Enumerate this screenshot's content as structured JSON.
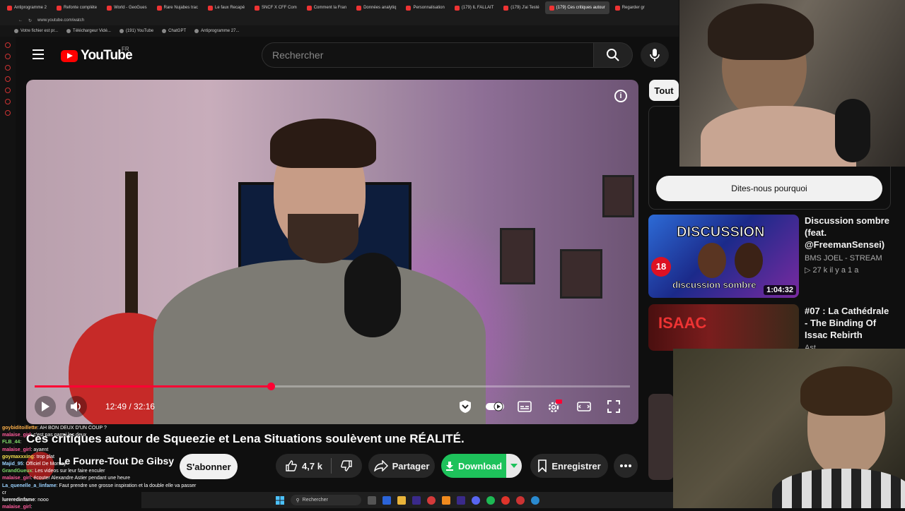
{
  "browser": {
    "tabs": [
      {
        "label": "Antiprogramme 2"
      },
      {
        "label": "Refonte complète"
      },
      {
        "label": "World - GeoGues"
      },
      {
        "label": "Rare Nujabes trac"
      },
      {
        "label": "Le faux Recapé"
      },
      {
        "label": "SNCF X CFF Com"
      },
      {
        "label": "Comment la Fran"
      },
      {
        "label": "Données analytiq"
      },
      {
        "label": "Personnalisation"
      },
      {
        "label": "(179) IL FALLAIT"
      },
      {
        "label": "(179) J'ai Testé"
      },
      {
        "label": "(179) Ces critiques autour"
      },
      {
        "label": "Regarder gr"
      }
    ],
    "url": "www.youtube.com/watch",
    "bookmarks": [
      {
        "label": "Votre fichier est pr..."
      },
      {
        "label": "Téléchargeur Vidé..."
      },
      {
        "label": "(191) YouTube"
      },
      {
        "label": "ChatGPT"
      },
      {
        "label": "Antiprogramme 27..."
      }
    ]
  },
  "header": {
    "logo_text": "YouTube",
    "country": "FR",
    "search_placeholder": "Rechercher"
  },
  "player": {
    "current_time": "12:49",
    "duration": "32:16",
    "time_display": "12:49 / 32:16",
    "progress_fraction": 0.397
  },
  "video": {
    "title": "Ces critiques autour de Squeezie et Lena Situations soulèvent une RÉALITÉ.",
    "channel": "Le Fourre-Tout De Gibsy",
    "subscribe_label": "S'abonner",
    "like_count": "4,7 k",
    "share_label": "Partager",
    "download_label": "Download",
    "save_label": "Enregistrer"
  },
  "sidebar": {
    "chip_all": "Tout",
    "feedback_button": "Dites-nous pourquoi",
    "recommendations": [
      {
        "title": "Discussion sombre (feat. @FreemanSensei)",
        "channel": "BMS JOEL - STREAM",
        "meta": "▷ 27 k  il y a 1 a",
        "duration": "1:04:32",
        "thumb_text": "DISCUSSION",
        "thumb_sub": "discussion sombre"
      },
      {
        "title": "#07 : La Cathédrale - The Binding Of Issac Rebirth",
        "channel": "Ast",
        "thumb_text": "ISAAC"
      }
    ]
  },
  "chat": [
    {
      "user": "goybiditoillette",
      "msg": "AH BON DEUX D'UN COUP ?"
    },
    {
      "user": "malaise_girl",
      "msg": "c'est pas parmi les deux"
    },
    {
      "user": "FLB_44",
      "msg": ""
    },
    {
      "user": "malaise_girl",
      "msg": "ayaent"
    },
    {
      "user": "goymaxxxing",
      "msg": "trop plat"
    },
    {
      "user": "Majid_95",
      "msg": "Officiel De Morsay"
    },
    {
      "user": "GrandGueux",
      "msg": "Les videos sur leur faire enculer"
    },
    {
      "user": "malaise_girl",
      "msg": "écouter Alexandre Astier pendant une heure"
    },
    {
      "user": "La_quenelle_a_linfame",
      "msg": "Faut prendre une grosse inspiration et la double elle va passer cr"
    },
    {
      "user": "lureredinfame",
      "msg": "nooo"
    },
    {
      "user": "malaise_girl",
      "msg": ""
    }
  ],
  "taskbar": {
    "search_label": "Rechercher"
  },
  "colors": {
    "brand_red": "#ff0000",
    "progress_red": "#ff0033",
    "download_green": "#1ec25b"
  }
}
